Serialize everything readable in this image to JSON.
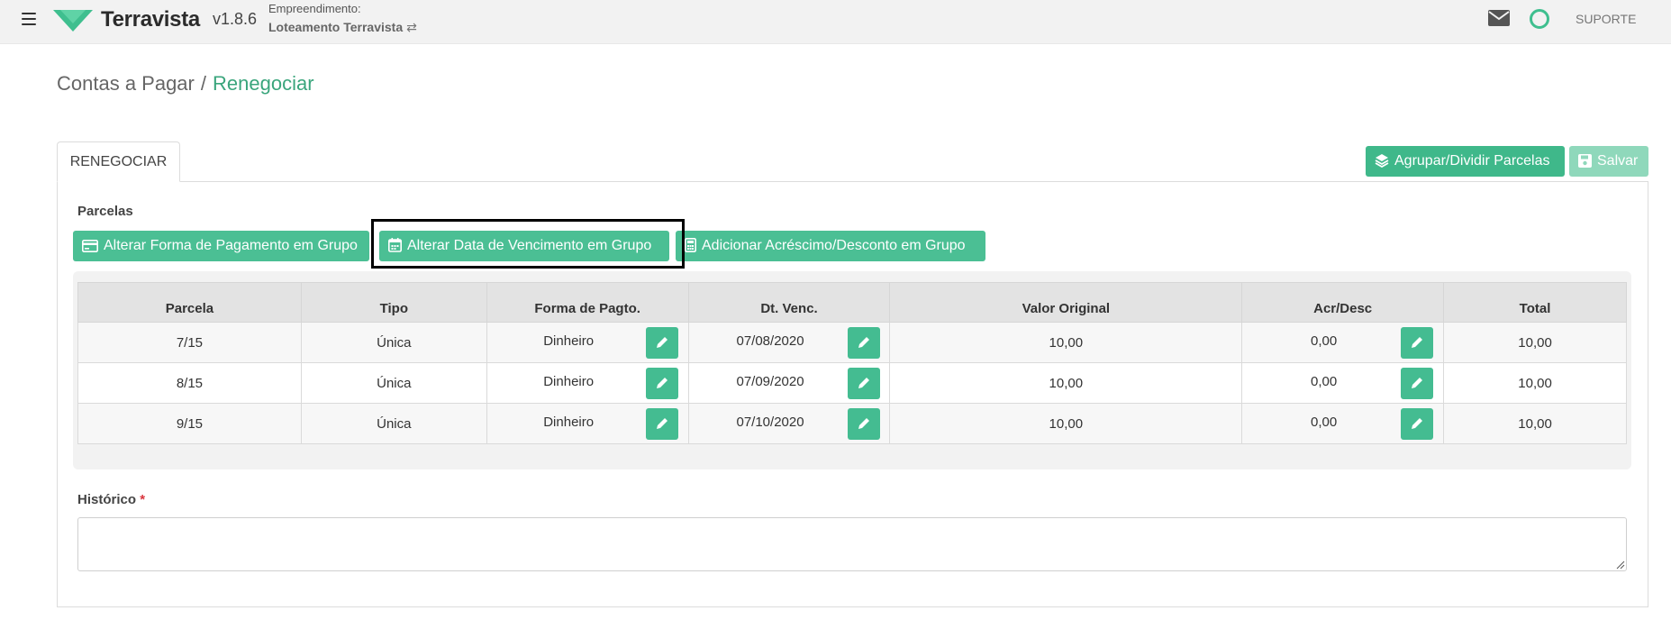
{
  "header": {
    "brand": "Terravista",
    "version": "v1.8.6",
    "empreendimento_label": "Empreendimento:",
    "empreendimento_name": "Loteamento Terravista",
    "swap_symbol": "⇄",
    "support_label": "SUPORTE",
    "brand_color": "#3fbf8f"
  },
  "breadcrumb": {
    "parent": "Contas a Pagar",
    "separator": "/",
    "current": "Renegociar"
  },
  "tabs": [
    {
      "label": "RENEGOCIAR"
    }
  ],
  "actions": {
    "agrupar_label": "Agrupar/Dividir Parcelas",
    "salvar_label": "Salvar"
  },
  "parcelas": {
    "label": "Parcelas",
    "buttons": {
      "forma": "Alterar Forma de Pagamento em Grupo",
      "data": "Alterar Data de Vencimento em Grupo",
      "acresc": "Adicionar Acréscimo/Desconto em Grupo"
    }
  },
  "table": {
    "headers": [
      "Parcela",
      "Tipo",
      "Forma de Pagto.",
      "Dt. Venc.",
      "Valor Original",
      "Acr/Desc",
      "Total"
    ],
    "rows": [
      {
        "parcela": "7/15",
        "tipo": "Única",
        "forma": "Dinheiro",
        "venc": "07/08/2020",
        "valor": "10,00",
        "acr": "0,00",
        "total": "10,00"
      },
      {
        "parcela": "8/15",
        "tipo": "Única",
        "forma": "Dinheiro",
        "venc": "07/09/2020",
        "valor": "10,00",
        "acr": "0,00",
        "total": "10,00"
      },
      {
        "parcela": "9/15",
        "tipo": "Única",
        "forma": "Dinheiro",
        "venc": "07/10/2020",
        "valor": "10,00",
        "acr": "0,00",
        "total": "10,00"
      }
    ]
  },
  "historico": {
    "label": "Histórico",
    "required_marker": "*",
    "value": ""
  },
  "icons": [
    "menu-icon",
    "logo-icon",
    "mail-icon",
    "status-ring-icon",
    "layers-icon",
    "save-icon",
    "credit-card-icon",
    "calendar-icon",
    "calculator-icon",
    "pencil-icon"
  ]
}
